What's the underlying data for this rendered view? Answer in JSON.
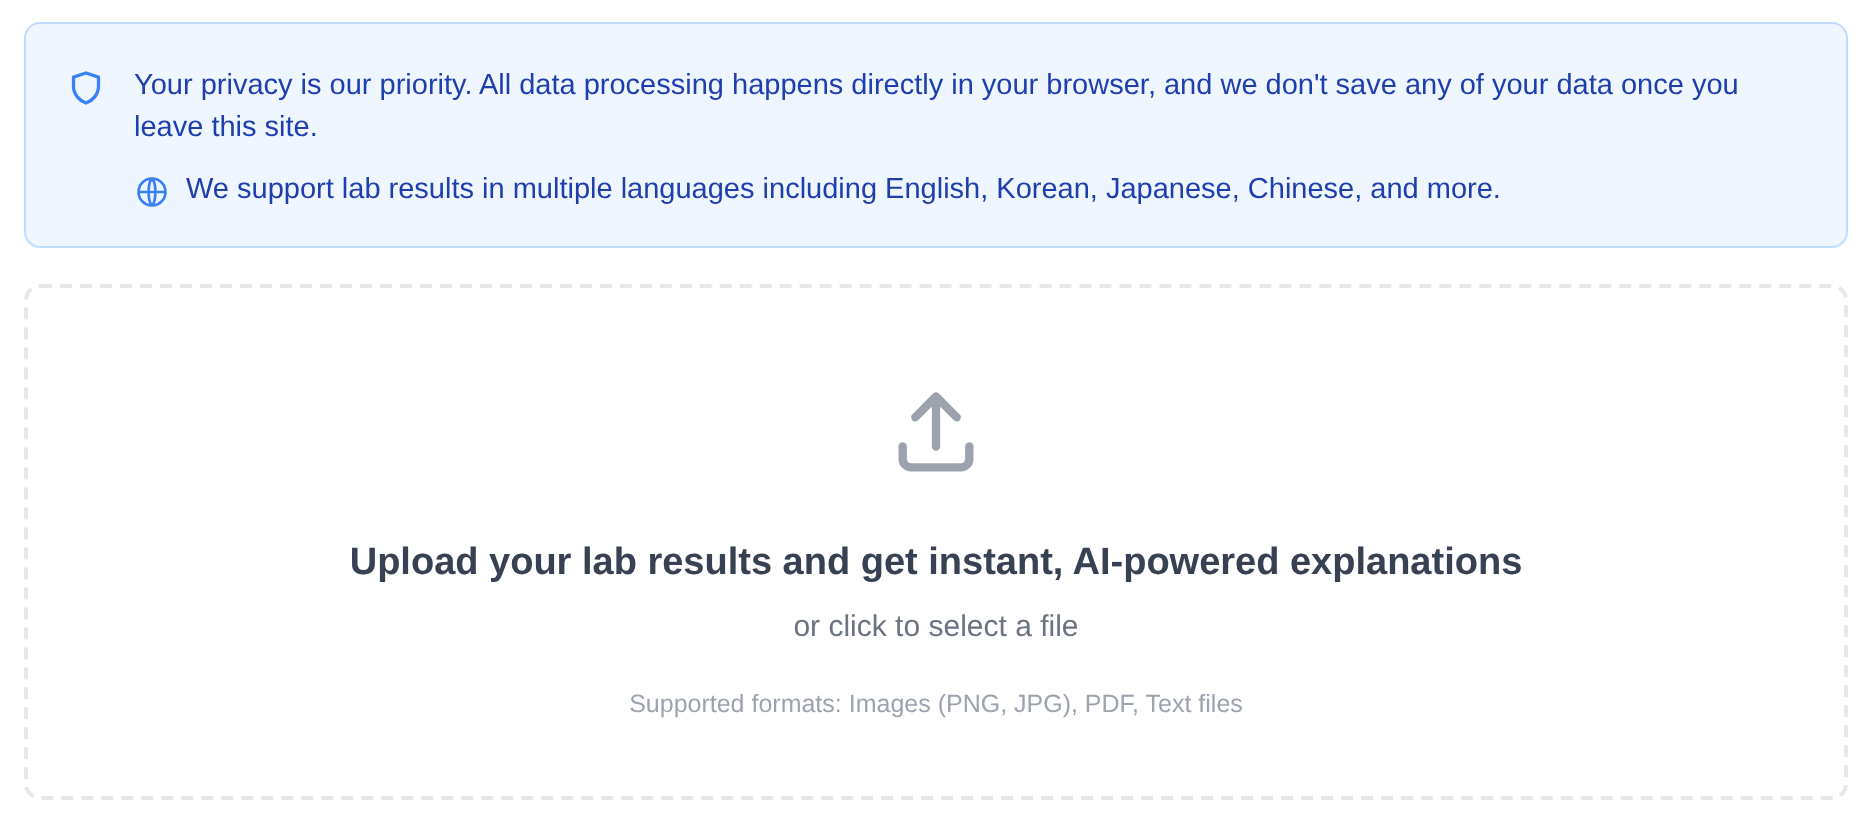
{
  "notice": {
    "privacy_text": "Your privacy is our priority. All data processing happens directly in your browser, and we don't save any of your data once you leave this site.",
    "languages_text": "We support lab results in multiple languages including English, Korean, Japanese, Chinese, and more."
  },
  "upload": {
    "title": "Upload your lab results and get instant, AI-powered explanations",
    "subtitle": "or click to select a file",
    "formats": "Supported formats: Images (PNG, JPG), PDF, Text files"
  }
}
